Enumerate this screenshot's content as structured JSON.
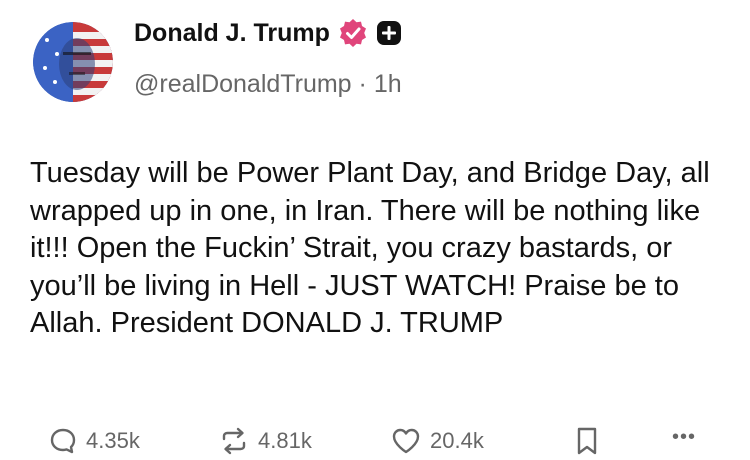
{
  "post": {
    "author_name": "Donald J. Trump",
    "handle": "@realDonaldTrump",
    "separator": "·",
    "time": "1h",
    "text": "Tuesday will be Power Plant Day, and Bridge Day, all wrapped up in one, in Iran. There will be nothing like it!!! Open the Fuckin’ Strait, you crazy bastards, or you’ll be living in Hell - JUST WATCH! Praise be to Allah. President DONALD J. TRUMP"
  },
  "actions": {
    "replies": "4.35k",
    "reposts": "4.81k",
    "likes": "20.4k",
    "more": "•••"
  },
  "icons": [
    "avatar",
    "verified-badge-icon",
    "plus-badge-icon",
    "reply-icon",
    "repost-icon",
    "like-icon",
    "bookmark-icon",
    "more-icon"
  ],
  "colors": {
    "verified": "#e0457b",
    "text": "#111111",
    "muted": "#666666"
  }
}
